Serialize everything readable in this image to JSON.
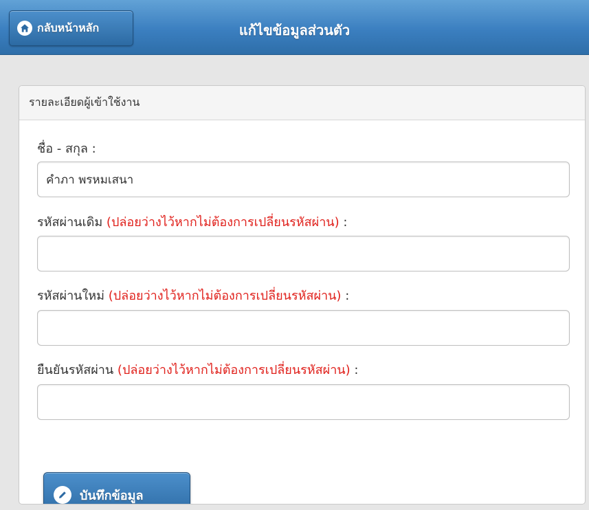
{
  "header": {
    "home_button_label": "กลับหน้าหลัก",
    "title": "แก้ไขข้อมูลส่วนตัว"
  },
  "panel": {
    "heading": "รายละเอียดผู้เข้าใช้งาน",
    "fields": [
      {
        "label": "ชื่อ - สกุล :",
        "note": "",
        "suffix": "",
        "value": "คำภา พรหมเสนา"
      },
      {
        "label": "รหัสผ่านเดิม",
        "note": "(ปล่อยว่างไว้หากไม่ต้องการเปลี่ยนรหัสผ่าน)",
        "suffix": " :",
        "value": ""
      },
      {
        "label": "รหัสผ่านใหม่",
        "note": "(ปล่อยว่างไว้หากไม่ต้องการเปลี่ยนรหัสผ่าน)",
        "suffix": " :",
        "value": ""
      },
      {
        "label": "ยืนยันรหัสผ่าน",
        "note": "(ปล่อยว่างไว้หากไม่ต้องการเปลี่ยนรหัสผ่าน)",
        "suffix": " :",
        "value": ""
      }
    ],
    "save_button_label": "บันทึกข้อมูล"
  },
  "icons": {
    "home": "home-icon",
    "save": "pencil-icon"
  },
  "colors": {
    "accent": "#3b7fc0",
    "note": "#e0201b"
  }
}
